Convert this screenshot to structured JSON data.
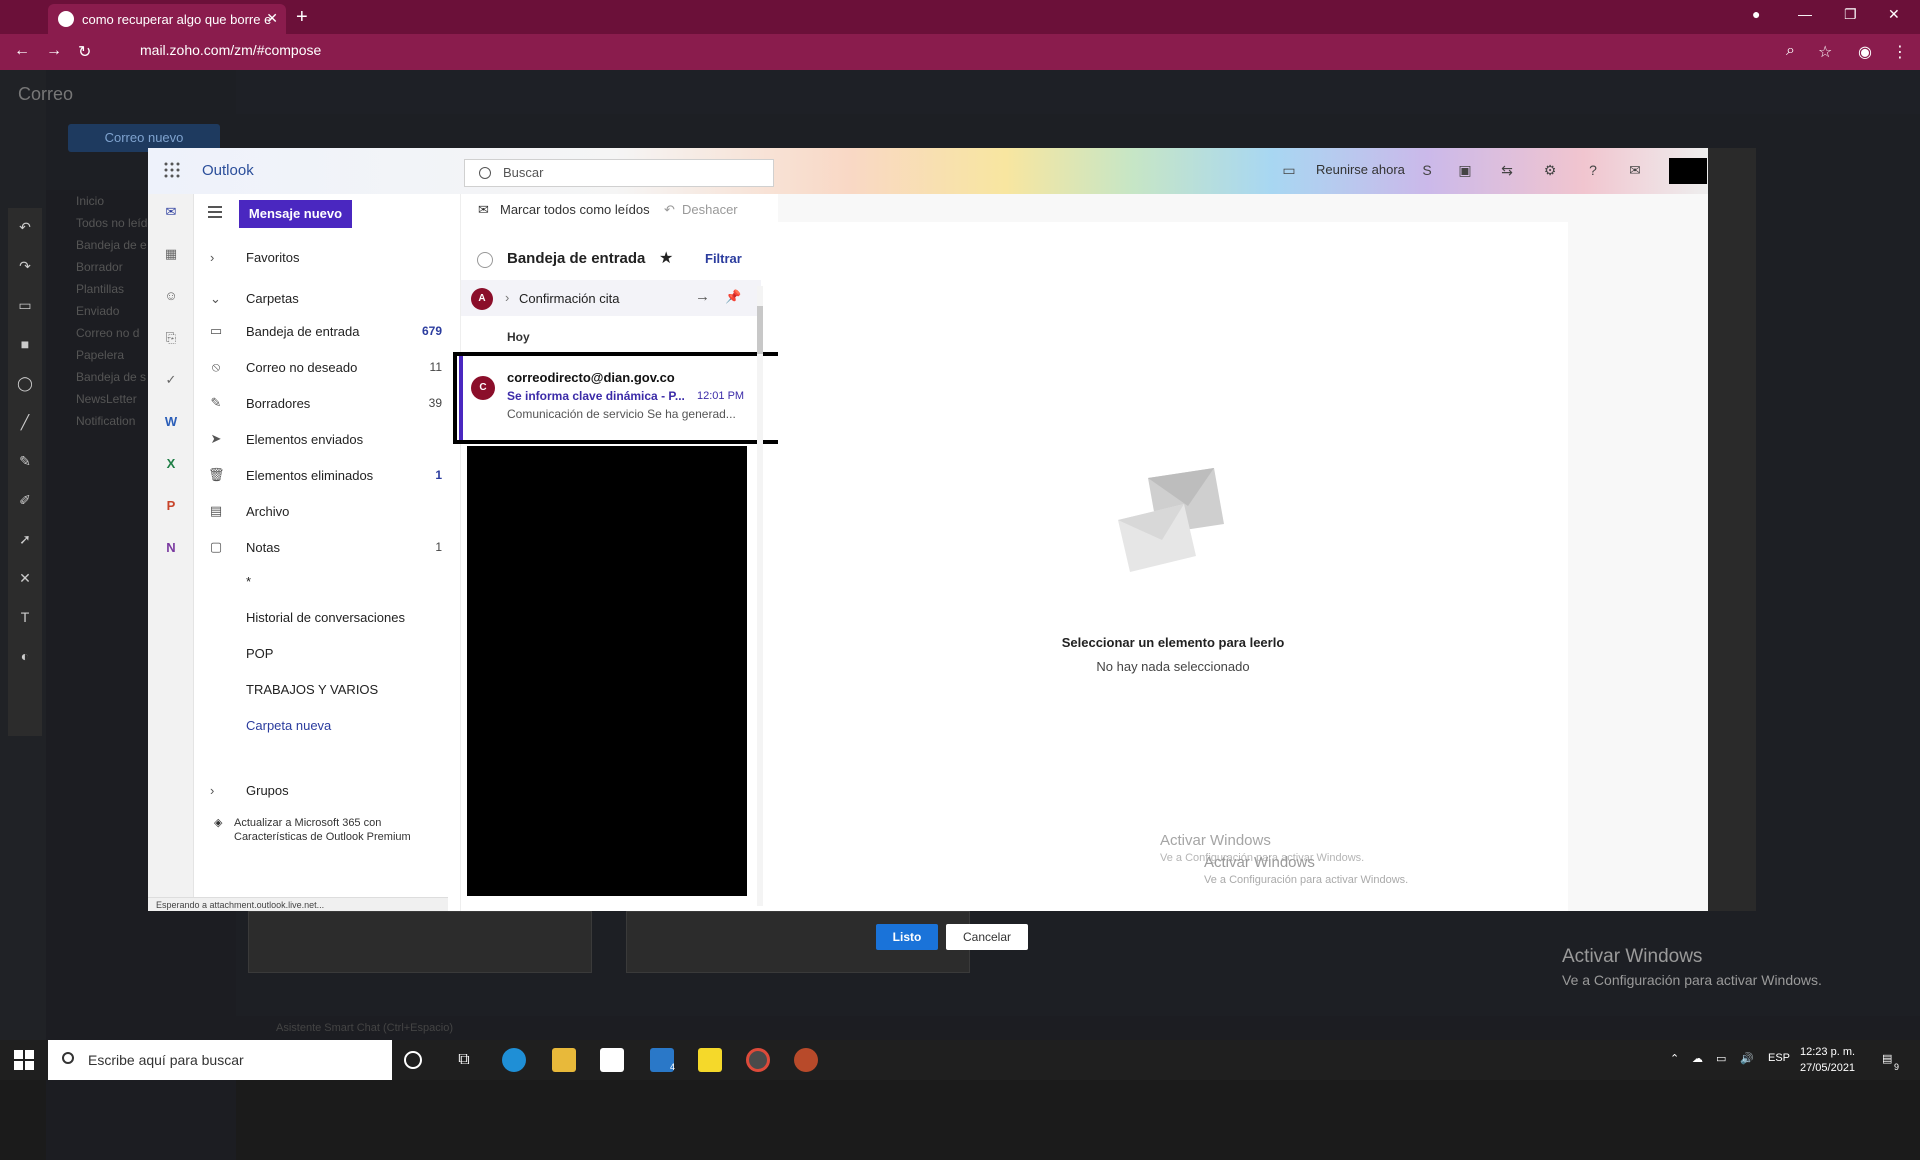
{
  "browser": {
    "tab_title": "como recuperar algo que borre e",
    "url": "mail.zoho.com/zm/#compose"
  },
  "zoho": {
    "app_name": "Correo",
    "new_mail": "Correo nuevo",
    "footer": "Asistente Smart Chat (Ctrl+Espacio)",
    "nav": [
      "Inicio",
      "Todos no leídos",
      "Bandeja de e",
      "Borrador",
      "Plantillas",
      "Enviado",
      "Correo no d",
      "Papelera",
      "Bandeja de s",
      "NewsLetter",
      "Notification"
    ]
  },
  "outlook": {
    "brand": "Outlook",
    "search_placeholder": "Buscar",
    "meet_now": "Reunirse ahora",
    "new_message": "Mensaje nuevo",
    "mark_all_read": "Marcar todos como leídos",
    "undo": "Deshacer",
    "favorites": "Favoritos",
    "folders_title": "Carpetas",
    "groups": "Grupos",
    "folders": [
      {
        "label": "Bandeja de entrada",
        "count": "679",
        "icon": "inbox-icon"
      },
      {
        "label": "Correo no deseado",
        "count": "11",
        "icon": "junk-icon"
      },
      {
        "label": "Borradores",
        "count": "39",
        "icon": "drafts-icon"
      },
      {
        "label": "Elementos enviados",
        "count": "",
        "icon": "sent-icon"
      },
      {
        "label": "Elementos eliminados",
        "count": "1",
        "icon": "trash-icon"
      },
      {
        "label": "Archivo",
        "count": "",
        "icon": "archive-icon"
      },
      {
        "label": "Notas",
        "count": "1",
        "icon": "notes-icon"
      },
      {
        "label": "*",
        "count": "",
        "icon": ""
      },
      {
        "label": "Historial de conversaciones",
        "count": "",
        "icon": ""
      },
      {
        "label": "POP",
        "count": "",
        "icon": ""
      },
      {
        "label": "TRABAJOS Y VARIOS",
        "count": "",
        "icon": ""
      },
      {
        "label": "Carpeta nueva",
        "count": "",
        "icon": ""
      }
    ],
    "upgrade": "Actualizar a Microsoft 365 con Características de Outlook Premium",
    "status": "Esperando a attachment.outlook.live.net...",
    "inbox_title": "Bandeja de entrada",
    "filter": "Filtrar",
    "pinned": {
      "avatar": "A",
      "subject": "Confirmación cita"
    },
    "group_today": "Hoy",
    "message": {
      "avatar": "C",
      "from": "correodirecto@dian.gov.co",
      "subject": "Se informa clave dinámica - P...",
      "time": "12:01 PM",
      "preview": "Comunicación de servicio Se ha generad..."
    },
    "reading_title": "Seleccionar un elemento para leerlo",
    "reading_sub": "No hay nada seleccionado",
    "watermark_title": "Activar Windows",
    "watermark_sub": "Ve a Configuración para activar Windows."
  },
  "dialog": {
    "ok": "Listo",
    "cancel": "Cancelar"
  },
  "desktop_watermark": {
    "title": "Activar Windows",
    "sub": "Ve a Configuración para activar Windows."
  },
  "taskbar": {
    "search_placeholder": "Escribe aquí para buscar",
    "lang": "ESP",
    "time": "12:23 p. m.",
    "date": "27/05/2021",
    "mail_badge": "4",
    "notif_count": "9"
  }
}
